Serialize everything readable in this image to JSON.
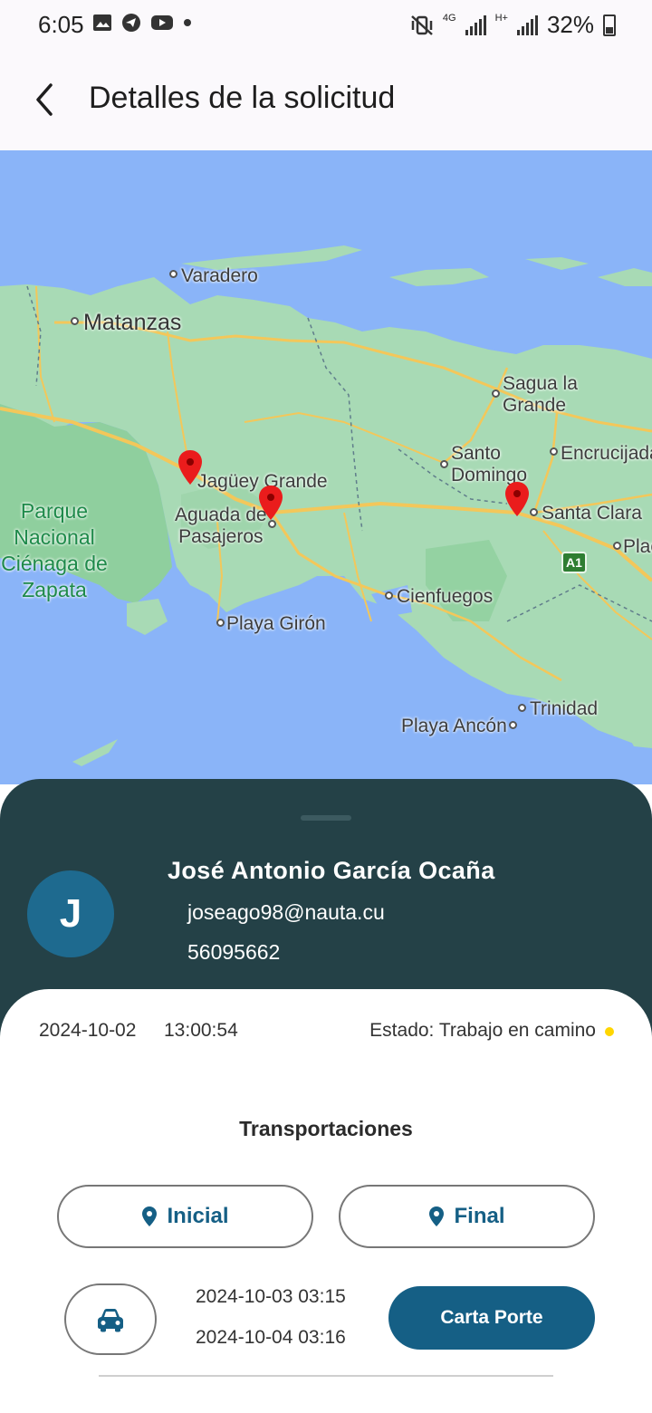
{
  "status_bar": {
    "time": "6:05",
    "battery": "32%",
    "network_4g": "4G",
    "network_h": "H+",
    "icons": [
      "image-icon",
      "telegram-icon",
      "youtube-icon",
      "dot-icon",
      "mute-vibrate-icon",
      "signal-icon",
      "battery-icon"
    ]
  },
  "header": {
    "title": "Detalles de la solicitud",
    "back_icon": "arrow-back-icon"
  },
  "map": {
    "labels": {
      "varadero": "Varadero",
      "matanzas": "Matanzas",
      "sagua": "Sagua la\nGrande",
      "jaguey": "Jagüey Grande",
      "santo_domingo": "Santo\nDomingo",
      "encrucijada": "Encrucijada",
      "parque": "Parque Nacional Ciénaga de Zapata",
      "aguada": "Aguada de\nPasajeros",
      "santa_clara": "Santa Clara",
      "placetas": "Plac",
      "cienfuegos": "Cienfuegos",
      "playa_giron": "Playa Girón",
      "trinidad": "Trinidad",
      "playa_ancon": "Playa Ancón",
      "highway": "A1"
    }
  },
  "user": {
    "initial": "J",
    "name": "José Antonio García Ocaña",
    "email": "joseago98@nauta.cu",
    "phone": "56095662"
  },
  "request": {
    "date": "2024-10-02",
    "time": "13:00:54",
    "status": "Estado: Trabajo en camino",
    "status_color": "#ffd600"
  },
  "transport": {
    "section_title": "Transportaciones",
    "initial_label": "Inicial",
    "final_label": "Final",
    "date_from": "2024-10-03 03:15",
    "date_to": "2024-10-04 03:16",
    "carta_label": "Carta Porte"
  },
  "colors": {
    "sheet": "#244147",
    "accent": "#155f85",
    "map_water": "#8ab4f8",
    "map_land": "#a8dab5"
  }
}
